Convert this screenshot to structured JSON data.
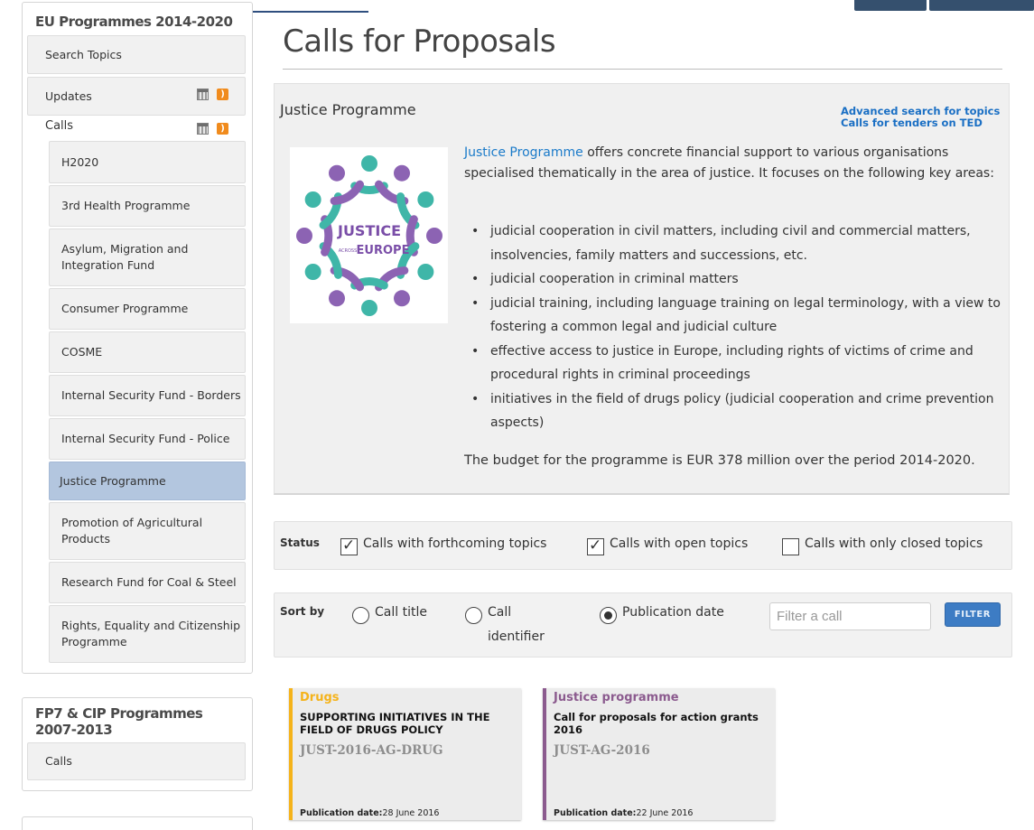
{
  "sidebar": {
    "eu_title": "EU Programmes 2014-2020",
    "search_topics": "Search Topics",
    "updates": "Updates",
    "calls": "Calls",
    "call_items": [
      "H2020",
      "3rd Health Programme",
      "Asylum, Migration and Integration Fund",
      "Consumer Programme",
      "COSME",
      "Internal Security Fund - Borders",
      "Internal Security Fund - Police",
      "Justice Programme",
      "Promotion of Agricultural Products",
      "Research Fund for Coal & Steel",
      "Rights, Equality and Citizenship Programme"
    ],
    "active_item": "Justice Programme",
    "fp7_title": "FP7 & CIP Programmes 2007-2013",
    "fp7_calls": "Calls",
    "icons": [
      "calendar-icon",
      "rss-icon"
    ]
  },
  "main": {
    "page_title": "Calls for Proposals",
    "programme_heading": "Justice Programme",
    "advanced_search_link": "Advanced search for topics",
    "tenders_link": "Calls for tenders on TED",
    "logo_text": {
      "line1": "JUSTICE",
      "line2": "ACROSS",
      "line3": "EUROPE"
    },
    "description_link": "Justice Programme",
    "description_rest": " offers concrete financial support to various organisations specialised thematically in the area of justice. It focuses on the following key areas:",
    "bullets": [
      "judicial cooperation in civil matters, including civil and commercial matters, insolvencies, family matters and successions, etc.",
      "judicial cooperation in criminal matters",
      "judicial training, including language training on legal terminology, with a view to fostering a common legal and judicial culture",
      "effective access to justice in Europe, including rights of victims of crime and procedural rights in criminal proceedings",
      "initiatives in the field of drugs policy (judicial cooperation and crime prevention aspects)"
    ],
    "budget": "The budget for the programme is EUR 378 million over the period 2014-2020."
  },
  "status_filter": {
    "label": "Status",
    "options": [
      {
        "label": "Calls with forthcoming topics",
        "checked": true
      },
      {
        "label": "Calls with open topics",
        "checked": true
      },
      {
        "label": "Calls with only closed topics",
        "checked": false
      }
    ]
  },
  "sort": {
    "label": "Sort by",
    "options": [
      {
        "label": "Call title",
        "selected": false
      },
      {
        "label_line1": "Call",
        "label_line2": "identifier",
        "selected": false
      },
      {
        "label": "Publication date",
        "selected": true
      }
    ],
    "filter_placeholder": "Filter a call",
    "filter_button": "FILTER"
  },
  "cards": [
    {
      "category": "Drugs",
      "title": "SUPPORTING INITIATIVES IN THE FIELD OF DRUGS POLICY",
      "identifier": "JUST-2016-AG-DRUG",
      "pub_label": "Publication date:",
      "pub_date": "28 June 2016",
      "accent": "#f5b31a"
    },
    {
      "category": "Justice programme",
      "title": "Call for proposals for action grants 2016",
      "identifier": "JUST-AG-2016",
      "pub_label": "Publication date:",
      "pub_date": "22 June 2016",
      "accent": "#8b5a8e"
    }
  ],
  "colors": {
    "link": "#1a7ac9",
    "active_menu": "#b3c6df",
    "filter_button": "#3d7cc4",
    "logo_teal": "#3fb6a8",
    "logo_purple": "#8c63b3"
  }
}
